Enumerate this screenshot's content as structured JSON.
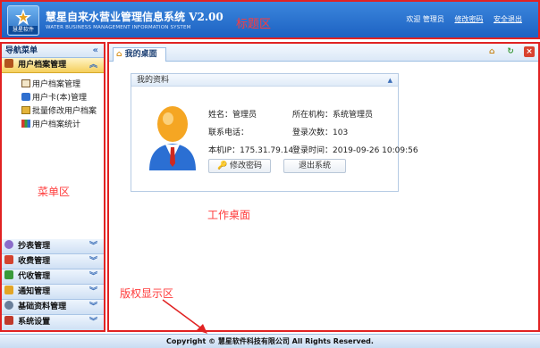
{
  "header": {
    "logo_caption": "慧星软件",
    "title": "慧星自来水营业管理信息系统 V2.00",
    "subtitle": "WATER BUSINESS MANAGEMENT INFORMATION SYSTEM",
    "annotation": "标题区",
    "welcome": "欢迎 管理员",
    "change_password": "修改密码",
    "logout": "安全退出"
  },
  "sidebar": {
    "title": "导航菜单",
    "collapse_glyph": "«",
    "active_group": {
      "label": "用户档案管理",
      "chevron": "︽"
    },
    "items": [
      {
        "label": "用户档案管理"
      },
      {
        "label": "用户卡(本)管理"
      },
      {
        "label": "批量修改用户档案"
      },
      {
        "label": "用户档案统计"
      }
    ],
    "annotation": "菜单区",
    "groups": [
      {
        "label": "抄表管理",
        "chevron": "︾"
      },
      {
        "label": "收费管理",
        "chevron": "︾"
      },
      {
        "label": "代收管理",
        "chevron": "︾"
      },
      {
        "label": "通知管理",
        "chevron": "︾"
      },
      {
        "label": "基础资料管理",
        "chevron": "︾"
      },
      {
        "label": "系统设置",
        "chevron": "︾"
      }
    ]
  },
  "main": {
    "tab_label": "我的桌面",
    "panel_title": "我的资料",
    "info": {
      "name_label": "姓名：管理员",
      "org_label": "所在机构：系统管理员",
      "phone_label": "联系电话：",
      "login_count": "登录次数：103",
      "ip_label": "本机IP：175.31.79.14",
      "login_time": "登录时间：2019-09-26 10:09:56"
    },
    "change_password_btn": "修改密码",
    "exit_btn": "退出系统",
    "annotation_desktop": "工作桌面",
    "annotation_copyright": "版权显示区"
  },
  "footer": {
    "copyright": "Copyright © 慧星软件科技有限公司 All Rights Reserved."
  },
  "colors": {
    "header_blue": "#2a72d0",
    "highlight_red": "#e12222",
    "active_group": "#f5cf5b"
  }
}
